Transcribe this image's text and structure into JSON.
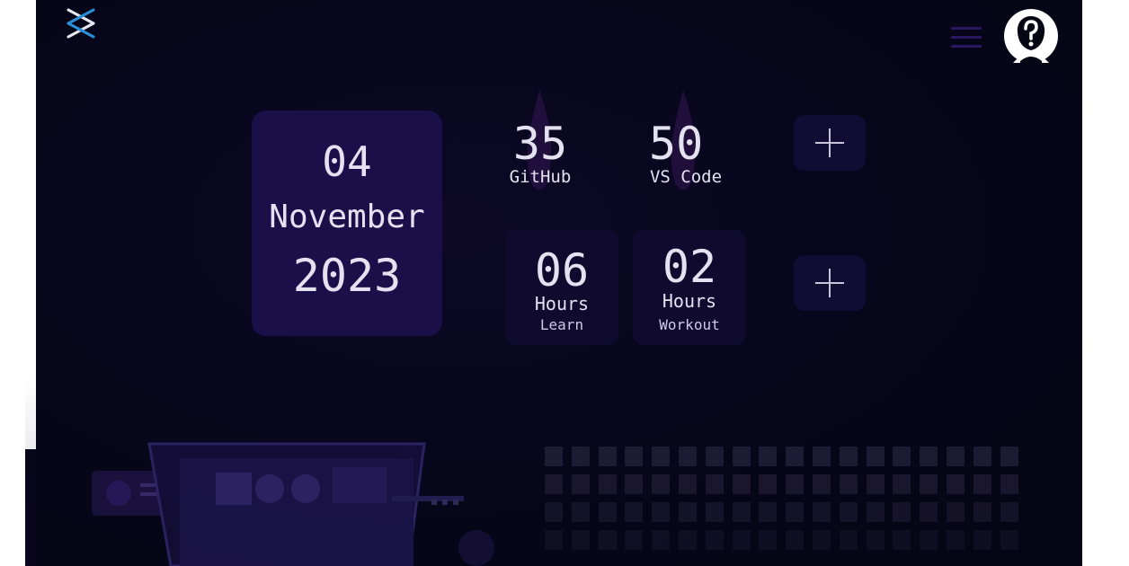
{
  "date": {
    "day": "04",
    "month": "November",
    "year": "2023"
  },
  "stats": [
    {
      "value": "35",
      "label": "GitHub"
    },
    {
      "value": "50",
      "label": "VS Code"
    }
  ],
  "hours": [
    {
      "value": "06",
      "unit": "Hours",
      "activity": "Learn"
    },
    {
      "value": "02",
      "unit": "Hours",
      "activity": "Workout"
    }
  ],
  "icons": {
    "logo": "x-logo-icon",
    "menu": "hamburger-menu-icon",
    "avatar": "question-mark-avatar-icon",
    "add": "plus-icon",
    "streak": "flame-icon"
  },
  "colors": {
    "background": "#07061a",
    "card": "#1a0f48",
    "accent": "#2a1760",
    "text": "#e4e1f1",
    "logo_primary": "#2b8fd8",
    "logo_secondary": "#e8e8f0"
  }
}
